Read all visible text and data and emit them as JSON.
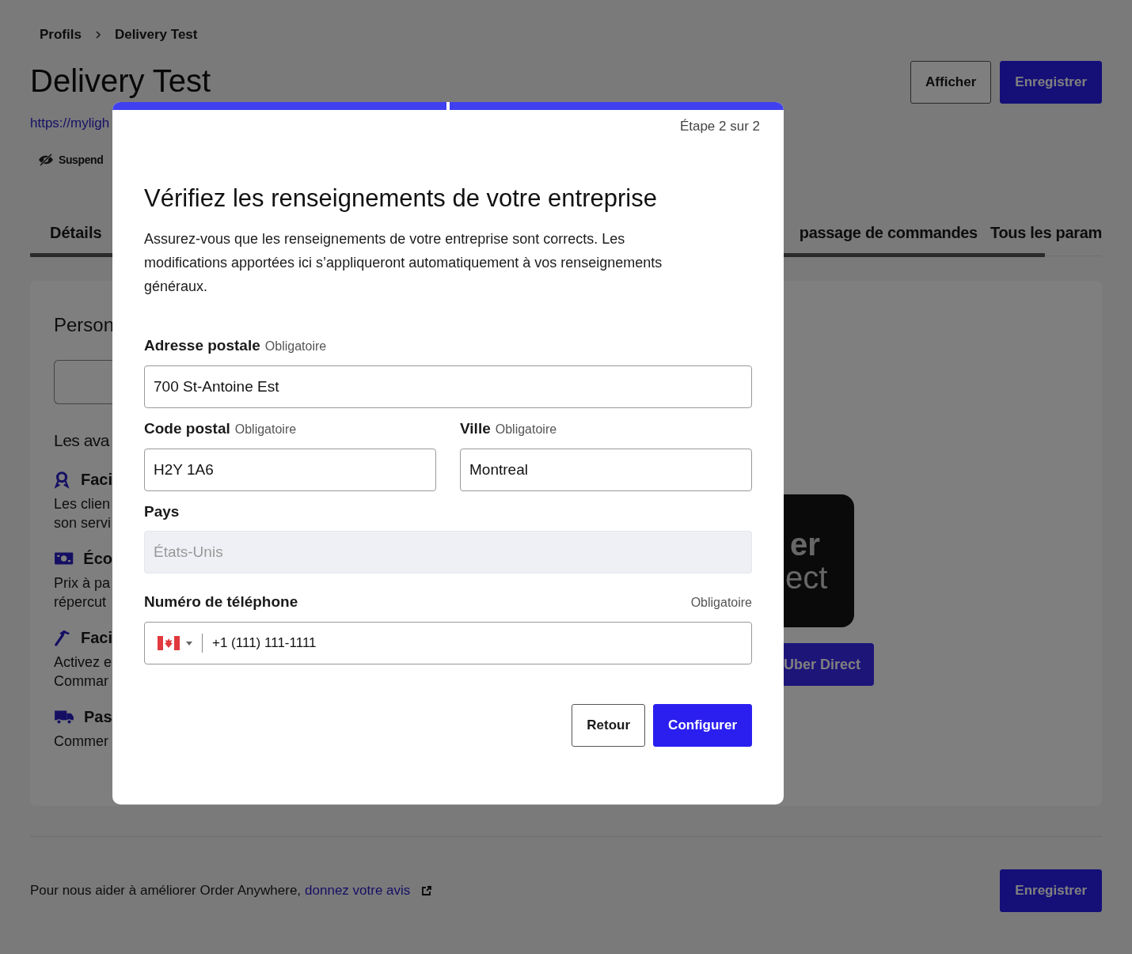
{
  "breadcrumb": [
    "Profils",
    "Delivery Test"
  ],
  "page_title": "Delivery Test",
  "header_buttons": [
    {
      "label": "Afficher",
      "primary": false
    },
    {
      "label": "Enregistrer",
      "primary": true
    }
  ],
  "url": "https://myligh",
  "suspend": "Suspend",
  "tabs": [
    {
      "label": "Détails"
    },
    {
      "label": "passage de commandes"
    },
    {
      "label": "Tous les param"
    }
  ],
  "card": {
    "section_title": "Person",
    "benefits_title": "Les ava",
    "benefits": [
      {
        "kind": "award",
        "title": "Faci",
        "lines": [
          "Les clien",
          "son servi"
        ]
      },
      {
        "kind": "money",
        "title": "Éco",
        "lines": [
          "Prix à pa",
          "répercut"
        ]
      },
      {
        "kind": "hammer",
        "title": "Faci",
        "lines": [
          "Activez e",
          "Commar"
        ]
      },
      {
        "kind": "truck",
        "title": "Pas",
        "lines": [
          "Commer"
        ]
      }
    ],
    "logo_lines": [
      "er",
      "ect"
    ],
    "connect_button": "Uber Direct"
  },
  "footer": {
    "text": "Pour nous aider à améliorer Order Anywhere,",
    "link": "donnez votre avis",
    "button": "Enregistrer"
  },
  "modal": {
    "progress": [
      {
        "completed": true
      },
      {
        "completed": true
      }
    ],
    "step": "Étape 2 sur 2",
    "title": "Vérifiez les renseignements de votre entreprise",
    "description": "Assurez-vous que les renseignements de votre entreprise sont corrects. Les modifications apportées ici s’appliqueront automatiquement à vos renseignements généraux.",
    "rows": [
      [
        {
          "kind": "text",
          "label": "Adresse postale",
          "hint": "Obligatoire",
          "value": "700 St-Antoine Est",
          "disabled": false
        }
      ],
      [
        {
          "kind": "text",
          "label": "Code postal",
          "hint": "Obligatoire",
          "value": "H2Y 1A6",
          "disabled": false
        },
        {
          "kind": "text",
          "label": "Ville",
          "hint": "Obligatoire",
          "value": "Montreal",
          "disabled": false
        }
      ],
      [
        {
          "kind": "text",
          "label": "Pays",
          "value": "États-Unis",
          "disabled": true
        }
      ],
      [
        {
          "kind": "phone",
          "label": "Numéro de téléphone",
          "hint": "Obligatoire",
          "value": "+1 (111) 111-1111",
          "disabled": false
        }
      ]
    ],
    "buttons": [
      {
        "label": "Retour",
        "primary": false
      },
      {
        "label": "Configurer",
        "primary": true
      }
    ]
  }
}
